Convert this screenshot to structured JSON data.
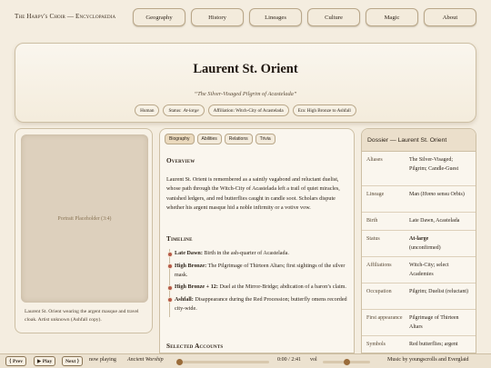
{
  "brand": "The Harpy's Choir — Encyclopaedia",
  "nav": [
    "Geography",
    "History",
    "Lineages",
    "Culture",
    "Magic",
    "About"
  ],
  "hero": {
    "title": "Laurent St. Orient",
    "subtitle": "“The Silver-Visaged Pilgrim of Acastelada”",
    "chips": {
      "human": "Human",
      "status_key": "Status:",
      "status_val": "At-large",
      "affiliation": "Affiliation: Witch-City of Acastelada",
      "era": "Era: High Bronze to Ashfall"
    }
  },
  "portrait": {
    "placeholder": "Portrait Placeholder (3:4)",
    "caption": "Laurent St. Orient wearing the argent masque and travel cloak. Artist unknown (Ashfall copy)."
  },
  "article": {
    "tabs": [
      "Biography",
      "Abilities",
      "Relations",
      "Trivia"
    ],
    "overview_heading": "Overview",
    "overview_text": "Laurent St. Orient is remembered as a saintly vagabond and reluctant duelist, whose path through the Witch-City of Acastelada left a trail of quiet miracles, vanished ledgers, and red butterflies caught in candle soot. Scholars dispute whether his argent masque hid a noble infirmity or a votive vow.",
    "timeline_heading": "Timeline",
    "timeline": [
      {
        "era": "Late Dawn:",
        "text": " Birth in the ash-quarter of Acastelada."
      },
      {
        "era": "High Bronze:",
        "text": " The Pilgrimage of Thirteen Altars; first sightings of the silver mask."
      },
      {
        "era": "High Bronze + 12:",
        "text": " Duel at the Mirror-Bridge; abdication of a baron’s claim."
      },
      {
        "era": "Ashfall:",
        "text": " Disappearance during the Red Procession; butterfly omens recorded city-wide."
      }
    ],
    "accounts_heading": "Selected Accounts"
  },
  "dossier": {
    "title": "Dossier — Laurent St. Orient",
    "rows": {
      "aliases": {
        "key": "Aliases",
        "val": "The Silver-Visaged; Pilgrim; Candle-Guest"
      },
      "lineage": {
        "key": "Lineage",
        "pre": "Man (",
        "it": "Homo",
        "post": " sensu Orbis)"
      },
      "birth": {
        "key": "Birth",
        "val": "Late Dawn, Acastelada"
      },
      "status": {
        "key": "Status",
        "bold": "At-large",
        "post": "(unconfirmed)"
      },
      "affiliations": {
        "key": "Affiliations",
        "val": "Witch-City; select Academies"
      },
      "occupation": {
        "key": "Occupation",
        "val": "Pilgrim; Duelist (reluctant)"
      },
      "first": {
        "key": "First appearance",
        "val": "Pilgrimage of Thirteen Altars"
      },
      "symbols": {
        "key": "Symbols",
        "val": "Red butterflies; argent"
      }
    }
  },
  "player": {
    "prev": "⟨ Prev",
    "play": "▶ Play",
    "next": "Next ⟩",
    "now_playing": "now playing",
    "track": "Ancient Worship",
    "time": "0:00 / 2:41",
    "vol": "vol",
    "credit": "Music by youngscrolls and Everglaid",
    "progress": 0.0,
    "volume": 0.5
  }
}
